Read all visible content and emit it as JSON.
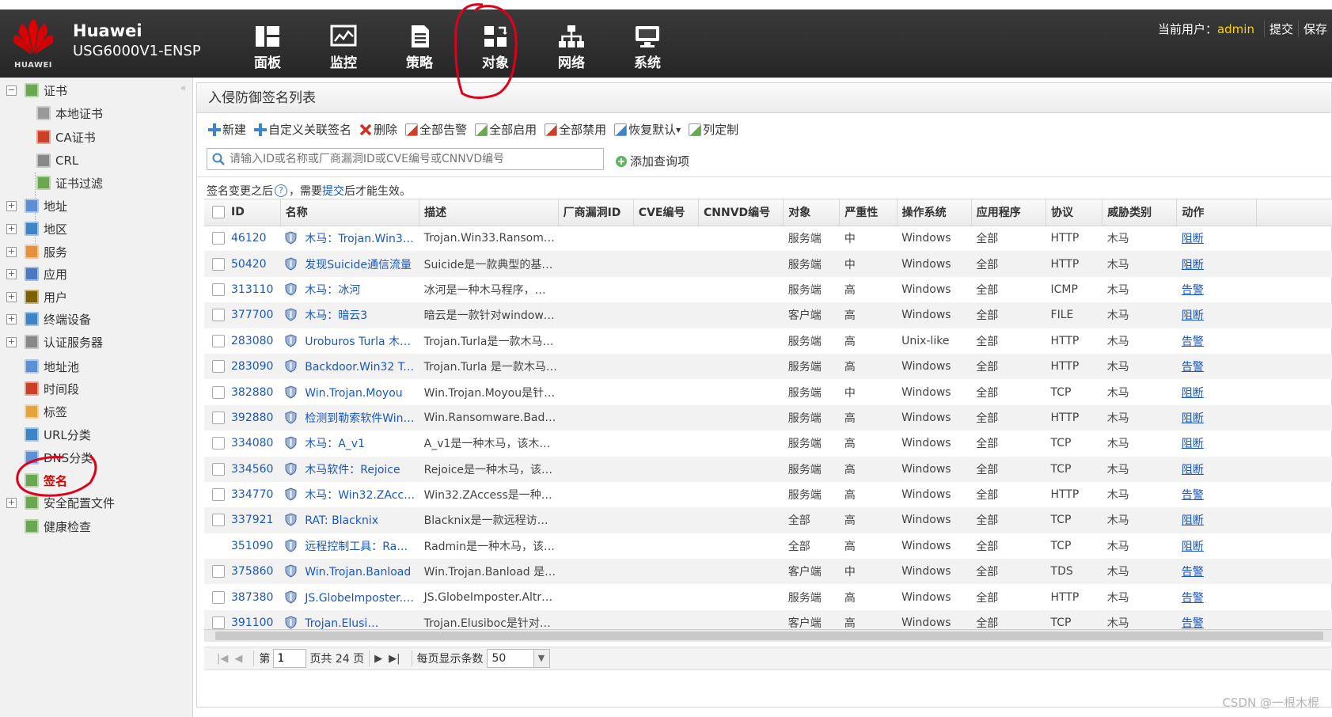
{
  "brand": {
    "name": "Huawei",
    "model": "USG6000V1-ENSP",
    "logo_text": "HUAWEI"
  },
  "nav": [
    {
      "id": "dashboard",
      "label": "面板",
      "icon": "dashboard-icon"
    },
    {
      "id": "monitor",
      "label": "监控",
      "icon": "monitor-icon"
    },
    {
      "id": "policy",
      "label": "策略",
      "icon": "policy-icon"
    },
    {
      "id": "object",
      "label": "对象",
      "icon": "object-icon",
      "active": true
    },
    {
      "id": "network",
      "label": "网络",
      "icon": "network-icon"
    },
    {
      "id": "system",
      "label": "系统",
      "icon": "system-icon"
    }
  ],
  "userbar": {
    "current_user_label": "当前用户：",
    "username": "admin",
    "commit": "提交",
    "save": "保存"
  },
  "sidebar": {
    "collapse": "«",
    "items": [
      {
        "label": "证书",
        "expander": "−",
        "icon": "certificate-icon",
        "color": "#6aa84f"
      },
      {
        "label": "本地证书",
        "icon": "local-cert-icon",
        "color": "#999999"
      },
      {
        "label": "CA证书",
        "icon": "ca-cert-icon",
        "color": "#cc4125"
      },
      {
        "label": "CRL",
        "icon": "crl-icon",
        "color": "#888888"
      },
      {
        "label": "证书过滤",
        "icon": "cert-filter-icon",
        "color": "#6aa84f"
      },
      {
        "label": "地址",
        "expander": "+",
        "icon": "address-icon",
        "color": "#5b8fd6"
      },
      {
        "label": "地区",
        "expander": "+",
        "icon": "region-icon",
        "color": "#3d85c6"
      },
      {
        "label": "服务",
        "expander": "+",
        "icon": "service-icon",
        "color": "#e69138"
      },
      {
        "label": "应用",
        "expander": "+",
        "icon": "application-icon",
        "color": "#4a78c2"
      },
      {
        "label": "用户",
        "expander": "+",
        "icon": "user-icon",
        "color": "#7f6000"
      },
      {
        "label": "终端设备",
        "expander": "+",
        "icon": "terminal-device-icon",
        "color": "#3d85c6"
      },
      {
        "label": "认证服务器",
        "expander": "+",
        "icon": "auth-server-icon",
        "color": "#888888"
      },
      {
        "label": "地址池",
        "icon": "address-pool-icon",
        "color": "#5b8fd6"
      },
      {
        "label": "时间段",
        "icon": "time-range-icon",
        "color": "#cc4125"
      },
      {
        "label": "标签",
        "icon": "tag-icon",
        "color": "#e6a23c"
      },
      {
        "label": "URL分类",
        "icon": "url-category-icon",
        "color": "#3d85c6"
      },
      {
        "label": "DNS分类",
        "icon": "dns-category-icon",
        "color": "#5b8fd6"
      },
      {
        "label": "签名",
        "icon": "signature-icon",
        "color": "#6aa84f",
        "selected": true
      },
      {
        "label": "安全配置文件",
        "expander": "+",
        "icon": "security-profile-icon",
        "color": "#6aa84f"
      },
      {
        "label": "健康检查",
        "icon": "health-check-icon",
        "color": "#6aa84f"
      }
    ]
  },
  "panel": {
    "title": "入侵防御签名列表",
    "toolbar": [
      {
        "label": "新建",
        "icon": "add-icon",
        "color": "#3d85c6"
      },
      {
        "label": "自定义关联签名",
        "icon": "add-icon",
        "color": "#3d85c6"
      },
      {
        "label": "删除",
        "icon": "delete-icon",
        "color": "#d62d20"
      },
      {
        "label": "全部告警",
        "icon": "alarm-all-icon",
        "color": "#cc4125"
      },
      {
        "label": "全部启用",
        "icon": "enable-all-icon",
        "color": "#6aa84f"
      },
      {
        "label": "全部禁用",
        "icon": "disable-all-icon",
        "color": "#cc4125"
      },
      {
        "label": "恢复默认",
        "icon": "restore-default-icon",
        "color": "#3d85c6"
      },
      {
        "label": "列定制",
        "icon": "column-custom-icon",
        "color": "#6aa84f"
      }
    ],
    "search_placeholder": "请输入ID或名称或厂商漏洞ID或CVE编号或CNNVD编号",
    "add_query": "添加查询项",
    "notice_before": "签名变更之后",
    "notice_mid": "，需要",
    "notice_link": "提交",
    "notice_after": "后才能生效。"
  },
  "table": {
    "columns": [
      "ID",
      "名称",
      "描述",
      "厂商漏洞ID",
      "CVE编号",
      "CNNVD编号",
      "对象",
      "严重性",
      "操作系统",
      "应用程序",
      "协议",
      "威胁类别",
      "动作"
    ],
    "rows": [
      {
        "id": "46120",
        "name": "木马：Trojan.Win3…",
        "desc": "Trojan.Win33.Ransom.…",
        "object": "服务端",
        "severity": "中",
        "os": "Windows",
        "app": "全部",
        "protocol": "HTTP",
        "threat": "木马",
        "action": "阻断",
        "checkbox": true
      },
      {
        "id": "50420",
        "name": "发现Suicide通信流量",
        "desc": "Suicide是一款典型的基…",
        "object": "服务端",
        "severity": "中",
        "os": "Windows",
        "app": "全部",
        "protocol": "HTTP",
        "threat": "木马",
        "action": "阻断",
        "checkbox": true
      },
      {
        "id": "313110",
        "name": "木马：冰河",
        "desc": "冰河是一种木马程序，…",
        "object": "服务端",
        "severity": "高",
        "os": "Windows",
        "app": "全部",
        "protocol": "ICMP",
        "threat": "木马",
        "action": "告警",
        "checkbox": true
      },
      {
        "id": "377700",
        "name": "木马：暗云3",
        "desc": "暗云是一款针对window…",
        "object": "客户端",
        "severity": "高",
        "os": "Windows",
        "app": "全部",
        "protocol": "FILE",
        "threat": "木马",
        "action": "阻断",
        "checkbox": true
      },
      {
        "id": "283080",
        "name": "Uroburos Turla 木…",
        "desc": "Trojan.Turla是一款木马…",
        "object": "服务端",
        "severity": "高",
        "os": "Unix-like",
        "app": "全部",
        "protocol": "HTTP",
        "threat": "木马",
        "action": "告警",
        "checkbox": true
      },
      {
        "id": "283090",
        "name": "Backdoor.Win32 Tu…",
        "desc": "Trojan.Turla 是一款木马…",
        "object": "服务端",
        "severity": "高",
        "os": "Windows",
        "app": "全部",
        "protocol": "HTTP",
        "threat": "木马",
        "action": "告警",
        "checkbox": true
      },
      {
        "id": "382880",
        "name": "Win.Trojan.Moyou",
        "desc": "Win.Trojan.Moyou是针…",
        "object": "服务端",
        "severity": "中",
        "os": "Windows",
        "app": "全部",
        "protocol": "TCP",
        "threat": "木马",
        "action": "阻断",
        "checkbox": true
      },
      {
        "id": "392880",
        "name": "检测到勒索软件Win…",
        "desc": "Win.Ransomware.Bad.…",
        "object": "服务端",
        "severity": "高",
        "os": "Windows",
        "app": "全部",
        "protocol": "HTTP",
        "threat": "木马",
        "action": "阻断",
        "checkbox": true
      },
      {
        "id": "334080",
        "name": "木马：A_v1",
        "desc": "A_v1是一种木马，该木…",
        "object": "服务端",
        "severity": "高",
        "os": "Windows",
        "app": "全部",
        "protocol": "TCP",
        "threat": "木马",
        "action": "阻断",
        "checkbox": true
      },
      {
        "id": "334560",
        "name": "木马软件：Rejoice",
        "desc": "Rejoice是一种木马，该…",
        "object": "服务端",
        "severity": "高",
        "os": "Windows",
        "app": "全部",
        "protocol": "TCP",
        "threat": "木马",
        "action": "阻断",
        "checkbox": true
      },
      {
        "id": "334770",
        "name": "木马：Win32.ZAcc…",
        "desc": "Win32.ZAccess是一种…",
        "object": "服务端",
        "severity": "高",
        "os": "Windows",
        "app": "全部",
        "protocol": "HTTP",
        "threat": "木马",
        "action": "告警",
        "checkbox": true
      },
      {
        "id": "337921",
        "name": "RAT: Blacknix",
        "desc": "Blacknix是一款远程访…",
        "object": "全部",
        "severity": "高",
        "os": "Windows",
        "app": "全部",
        "protocol": "TCP",
        "threat": "木马",
        "action": "阻断",
        "checkbox": true
      },
      {
        "id": "351090",
        "name": "远程控制工具：Ra…",
        "desc": "Radmin是一种木马，该…",
        "object": "全部",
        "severity": "高",
        "os": "Windows",
        "app": "全部",
        "protocol": "TCP",
        "threat": "木马",
        "action": "阻断",
        "checkbox": false
      },
      {
        "id": "375860",
        "name": "Win.Trojan.Banload",
        "desc": "Win.Trojan.Banload 是…",
        "object": "客户端",
        "severity": "中",
        "os": "Windows",
        "app": "全部",
        "protocol": "TDS",
        "threat": "木马",
        "action": "告警",
        "checkbox": true
      },
      {
        "id": "387380",
        "name": "JS.GlobeImposter.…",
        "desc": "JS.GlobeImposter.Altr…",
        "object": "服务端",
        "severity": "高",
        "os": "Windows",
        "app": "全部",
        "protocol": "HTTP",
        "threat": "木马",
        "action": "告警",
        "checkbox": true
      },
      {
        "id": "391100",
        "name": "Trojan.Elusi…",
        "desc": "Trojan.Elusiboc是针对…",
        "object": "客户端",
        "severity": "高",
        "os": "Windows",
        "app": "全部",
        "protocol": "TCP",
        "threat": "木马",
        "action": "告警",
        "checkbox": true
      }
    ]
  },
  "pager": {
    "first": "|◀",
    "prev": "◀",
    "next": "▶",
    "last": "▶|",
    "page_label": "第",
    "page_value": "1",
    "total_label": "页共 24 页",
    "per_page_label": "每页显示条数",
    "per_page_value": "50",
    "dropdown": "▼"
  },
  "watermark": "CSDN @一根木棍",
  "colors": {
    "header_bg": "#2e2e2e",
    "link": "#1a56c7",
    "selected": "#d40000",
    "annotation": "#e0001a",
    "accent_user": "#ffd400"
  }
}
